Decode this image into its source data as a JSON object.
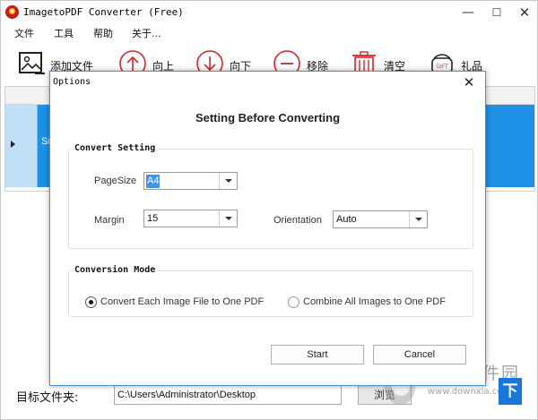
{
  "window": {
    "title": "ImagetoPDF Converter (Free)",
    "minimize": "—",
    "maximize": "☐",
    "close": "✕"
  },
  "menu": {
    "items": [
      {
        "label": "文件"
      },
      {
        "label": "工具"
      },
      {
        "label": "帮助"
      },
      {
        "label": "关于..."
      }
    ]
  },
  "toolbar": {
    "add_files": {
      "label": "添加文件",
      "icon": "image-icon"
    },
    "move_up": {
      "label": "向上",
      "icon": "arrow-up-icon"
    },
    "move_down": {
      "label": "向下",
      "icon": "arrow-down-icon"
    },
    "remove": {
      "label": "移除",
      "icon": "minus-icon"
    },
    "clear": {
      "label": "清空",
      "icon": "trash-icon"
    },
    "gift": {
      "label": "礼品",
      "icon": "gift-icon",
      "badge": "GIFT"
    }
  },
  "file_list": {
    "selected_row_text": "Sn"
  },
  "bottom": {
    "target_label": "目标文件夹:",
    "target_path": "C:\\Users\\Administrator\\Desktop",
    "browse_label": "浏览"
  },
  "dialog": {
    "title": "Options",
    "close": "✕",
    "heading": "Setting Before Converting",
    "convert_setting": {
      "group_title": "Convert Setting",
      "pagesize_label": "PageSize",
      "pagesize_value": "A4",
      "margin_label": "Margin",
      "margin_value": "15",
      "orientation_label": "Orientation",
      "orientation_value": "Auto"
    },
    "conversion_mode": {
      "group_title": "Conversion Mode",
      "options": [
        {
          "label": "Convert Each Image File to One PDF",
          "checked": true
        },
        {
          "label": "Combine All Images to One PDF",
          "checked": false
        }
      ]
    },
    "start_label": "Start",
    "cancel_label": "Cancel"
  },
  "watermark": {
    "name": "当下软件园",
    "url": "www.downxia.com",
    "badge": "下"
  },
  "colors": {
    "selection_blue": "#1e90e6",
    "dialog_border": "#4a90d9",
    "tool_icon_red": "#d4252c",
    "logo_red": "#c8181e"
  }
}
